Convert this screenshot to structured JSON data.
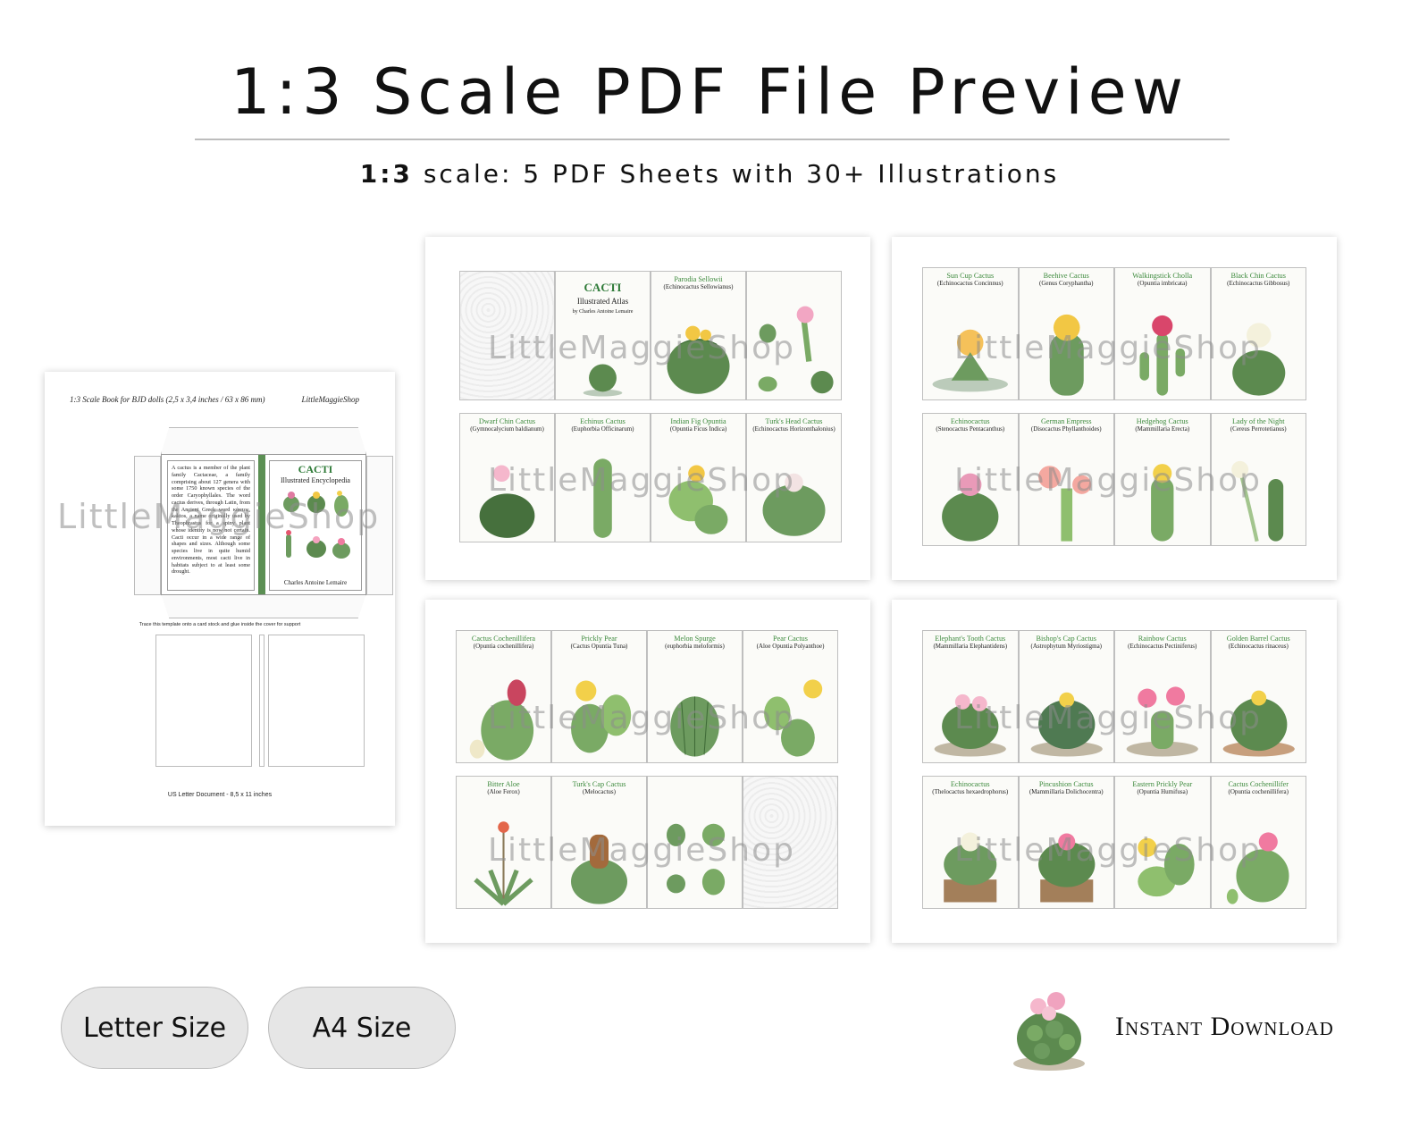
{
  "header": {
    "title": "1:3 Scale PDF File Preview",
    "subtitle_bold": "1:3",
    "subtitle_rest": " scale: 5 PDF Sheets with 30+ Illustrations"
  },
  "letter_sheet": {
    "header": "1:3 Scale Book for BJD dolls (2,5 x 3,4 inches / 63 x 86 mm)",
    "brand": "LittleMaggieShop",
    "back_text": "A cactus is a member of the plant family Cactaceae, a family comprising about 127 genera with some 1750 known species of the order Caryophyllales. The word cactus derives, through Latin, from the Ancient Greek word κάκτος, kaktos, a name originally used by Theophrastus for a spiny plant whose identity is now not certain. Cacti occur in a wide range of shapes and sizes. Although some species live in quite humid environments, most cacti live in habitats subject to at least some drought.",
    "cover_title": "CACTI",
    "cover_sub": "Illustrated Encyclopedia",
    "cover_author": "Charles Antoine Lemaire",
    "note": "Trace this template onto a card stock and glue inside the cover for support",
    "footer": "US Letter Document - 8,5 x 11 inches"
  },
  "watermark": "LittleMaggieShop",
  "sheet1": {
    "cover": {
      "title": "CACTI",
      "sub": "Illustrated Atlas",
      "author": "by Charles Antoine Lemaire"
    },
    "cells": [
      {
        "name": "Parodia Sellowii",
        "latin": "(Echinocactus Sellowianus)"
      },
      {
        "name": "",
        "latin": ""
      },
      {
        "name": "Dwarf Chin Cactus",
        "latin": "(Gymnocalycium baldianum)"
      },
      {
        "name": "Echinus Cactus",
        "latin": "(Euphorbia Officinarum)"
      },
      {
        "name": "Indian Fig Opuntia",
        "latin": "(Opuntia Ficus Indica)"
      },
      {
        "name": "Turk's Head Cactus",
        "latin": "(Echinocactus Horizonthalonius)"
      }
    ]
  },
  "sheet2": {
    "cells": [
      {
        "name": "Sun Cup Cactus",
        "latin": "(Echinocactus Concinnus)"
      },
      {
        "name": "Beehive Cactus",
        "latin": "(Genus Coryphantha)"
      },
      {
        "name": "Walkingstick Cholla",
        "latin": "(Opuntia imbricata)"
      },
      {
        "name": "Black Chin Cactus",
        "latin": "(Echinocactus Gibbosus)"
      },
      {
        "name": "Echinocactus",
        "latin": "(Stenocactus Pentacanthus)"
      },
      {
        "name": "German Empress",
        "latin": "(Disocactus Phyllanthoides)"
      },
      {
        "name": "Hedgehog Cactus",
        "latin": "(Mammillaria Erecta)"
      },
      {
        "name": "Lady of the Night",
        "latin": "(Cereus Perrotetianus)"
      }
    ]
  },
  "sheet3": {
    "cells": [
      {
        "name": "Cactus Cochenillifera",
        "latin": "(Opuntia cochenillifera)"
      },
      {
        "name": "Prickly Pear",
        "latin": "(Cactus Opuntia Tuna)"
      },
      {
        "name": "Melon Spurge",
        "latin": "(euphorbia meloformis)"
      },
      {
        "name": "Pear Cactus",
        "latin": "(Aloe Opuntia Polyanthoe)"
      },
      {
        "name": "Bitter Aloe",
        "latin": "(Aloe Ferox)"
      },
      {
        "name": "Turk's Cap Cactus",
        "latin": "(Melocactus)"
      },
      {
        "name": "",
        "latin": ""
      }
    ]
  },
  "sheet4": {
    "cells": [
      {
        "name": "Elephant's Tooth Cactus",
        "latin": "(Mammillaria Elephantidens)"
      },
      {
        "name": "Bishop's Cap Cactus",
        "latin": "(Astrophytum Myriostigma)"
      },
      {
        "name": "Rainbow Cactus",
        "latin": "(Echinocactus Pectiniferus)"
      },
      {
        "name": "Golden Barrel Cactus",
        "latin": "(Echinocactus rinaceus)"
      },
      {
        "name": "Echinocactus",
        "latin": "(Thelocactus hexaedrophorus)"
      },
      {
        "name": "Pincushion Cactus",
        "latin": "(Mammillaria Dolichocentra)"
      },
      {
        "name": "Eastern Prickly Pear",
        "latin": "(Opuntia Humifusa)"
      },
      {
        "name": "Cactus Cochenillifer",
        "latin": "(Opuntia cochenillifera)"
      }
    ]
  },
  "buttons": {
    "letter": "Letter Size",
    "a4": "A4 Size"
  },
  "instant": "Instant Download",
  "colors": {
    "accent_green": "#3d8a3d",
    "spine_green": "#5b8f53",
    "pill_bg": "#e6e6e6"
  }
}
